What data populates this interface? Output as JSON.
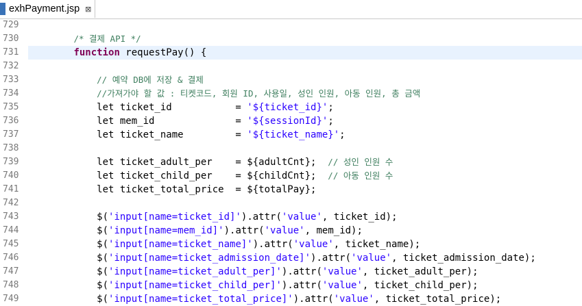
{
  "tab": {
    "title": "exhPayment.jsp",
    "close": "⊠"
  },
  "colors": {
    "keyword": "#7f0055",
    "string": "#2a00ff",
    "comment": "#3f7f5f",
    "current_line": "#e8f2fe"
  },
  "lines": [
    {
      "num": "729",
      "tokens": []
    },
    {
      "num": "730",
      "tokens": [
        {
          "t": "        ",
          "c": ""
        },
        {
          "t": "/* 결제 API */",
          "c": "cm"
        }
      ]
    },
    {
      "num": "731",
      "current": true,
      "tokens": [
        {
          "t": "        ",
          "c": ""
        },
        {
          "t": "function",
          "c": "kw"
        },
        {
          "t": " requestPay() {",
          "c": ""
        }
      ]
    },
    {
      "num": "732",
      "tokens": []
    },
    {
      "num": "733",
      "tokens": [
        {
          "t": "            ",
          "c": ""
        },
        {
          "t": "// 예약 DB에 저장 & 결제",
          "c": "cm"
        }
      ]
    },
    {
      "num": "734",
      "tokens": [
        {
          "t": "            ",
          "c": ""
        },
        {
          "t": "//가져가야 할 값 : 티켓코드, 회원 ID, 사용일, 성인 인원, 아동 인원, 총 금액",
          "c": "cm"
        }
      ]
    },
    {
      "num": "735",
      "tokens": [
        {
          "t": "            let ticket_id           = ",
          "c": ""
        },
        {
          "t": "'${ticket_id}'",
          "c": "str"
        },
        {
          "t": ";",
          "c": ""
        }
      ]
    },
    {
      "num": "736",
      "tokens": [
        {
          "t": "            let mem_id              = ",
          "c": ""
        },
        {
          "t": "'${sessionId}'",
          "c": "str"
        },
        {
          "t": ";",
          "c": ""
        }
      ]
    },
    {
      "num": "737",
      "tokens": [
        {
          "t": "            let ticket_name         = ",
          "c": ""
        },
        {
          "t": "'${ticket_name}'",
          "c": "str"
        },
        {
          "t": ";",
          "c": ""
        }
      ]
    },
    {
      "num": "738",
      "tokens": []
    },
    {
      "num": "739",
      "tokens": [
        {
          "t": "            let ticket_adult_per    = ${adultCnt};  ",
          "c": ""
        },
        {
          "t": "// 성인 인원 수",
          "c": "cm"
        }
      ]
    },
    {
      "num": "740",
      "tokens": [
        {
          "t": "            let ticket_child_per    = ${childCnt};  ",
          "c": ""
        },
        {
          "t": "// 아동 인원 수",
          "c": "cm"
        }
      ]
    },
    {
      "num": "741",
      "tokens": [
        {
          "t": "            let ticket_total_price  = ${totalPay};",
          "c": ""
        }
      ]
    },
    {
      "num": "742",
      "tokens": []
    },
    {
      "num": "743",
      "tokens": [
        {
          "t": "            $(",
          "c": ""
        },
        {
          "t": "'input[name=ticket_id]'",
          "c": "str"
        },
        {
          "t": ").attr(",
          "c": ""
        },
        {
          "t": "'value'",
          "c": "str"
        },
        {
          "t": ", ticket_id);",
          "c": ""
        }
      ]
    },
    {
      "num": "744",
      "tokens": [
        {
          "t": "            $(",
          "c": ""
        },
        {
          "t": "'input[name=mem_id]'",
          "c": "str"
        },
        {
          "t": ").attr(",
          "c": ""
        },
        {
          "t": "'value'",
          "c": "str"
        },
        {
          "t": ", mem_id);",
          "c": ""
        }
      ]
    },
    {
      "num": "745",
      "tokens": [
        {
          "t": "            $(",
          "c": ""
        },
        {
          "t": "'input[name=ticket_name]'",
          "c": "str"
        },
        {
          "t": ").attr(",
          "c": ""
        },
        {
          "t": "'value'",
          "c": "str"
        },
        {
          "t": ", ticket_name);",
          "c": ""
        }
      ]
    },
    {
      "num": "746",
      "tokens": [
        {
          "t": "            $(",
          "c": ""
        },
        {
          "t": "'input[name=ticket_admission_date]'",
          "c": "str"
        },
        {
          "t": ").attr(",
          "c": ""
        },
        {
          "t": "'value'",
          "c": "str"
        },
        {
          "t": ", ticket_admission_date);",
          "c": ""
        }
      ]
    },
    {
      "num": "747",
      "tokens": [
        {
          "t": "            $(",
          "c": ""
        },
        {
          "t": "'input[name=ticket_adult_per]'",
          "c": "str"
        },
        {
          "t": ").attr(",
          "c": ""
        },
        {
          "t": "'value'",
          "c": "str"
        },
        {
          "t": ", ticket_adult_per);",
          "c": ""
        }
      ]
    },
    {
      "num": "748",
      "tokens": [
        {
          "t": "            $(",
          "c": ""
        },
        {
          "t": "'input[name=ticket_child_per]'",
          "c": "str"
        },
        {
          "t": ").attr(",
          "c": ""
        },
        {
          "t": "'value'",
          "c": "str"
        },
        {
          "t": ", ticket_child_per);",
          "c": ""
        }
      ]
    },
    {
      "num": "749",
      "tokens": [
        {
          "t": "            $(",
          "c": ""
        },
        {
          "t": "'input[name=ticket_total_price]'",
          "c": "str"
        },
        {
          "t": ").attr(",
          "c": ""
        },
        {
          "t": "'value'",
          "c": "str"
        },
        {
          "t": ", ticket_total_price);",
          "c": ""
        }
      ]
    }
  ]
}
